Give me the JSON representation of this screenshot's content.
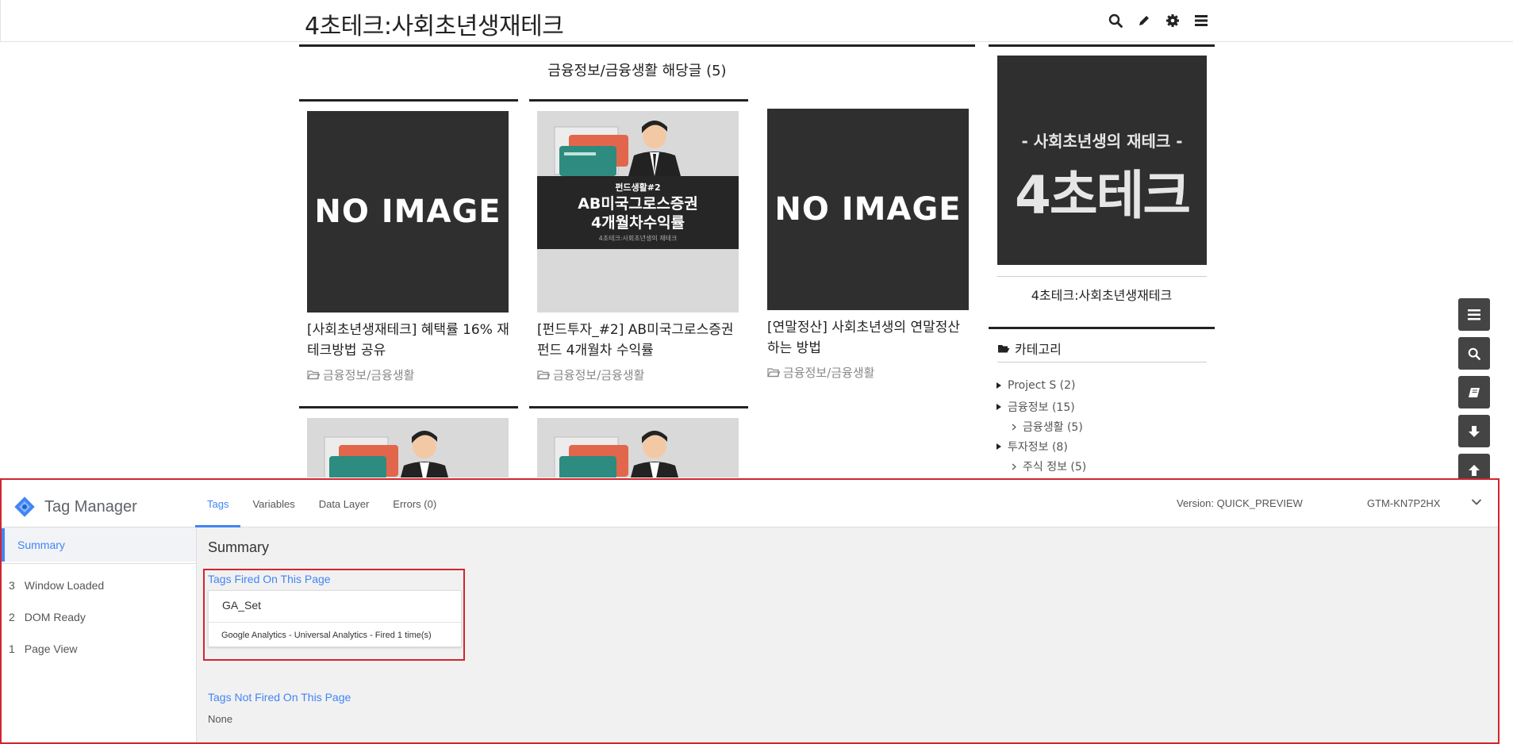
{
  "blog": {
    "title": "4초테크:사회초년생재테크",
    "heading": "금융정보/금융생활 해당글 (5)",
    "header_icons": [
      "search-icon",
      "pencil-icon",
      "gear-icon",
      "menu-icon"
    ],
    "posts": [
      {
        "thumb": "NO IMAGE",
        "title": "[사회초년생재테크] 혜택률 16% 재테크방법 공유",
        "category": "금융정보/금융생활"
      },
      {
        "thumb_l1": "펀드생활#2",
        "thumb_l2": "AB미국그로스증권",
        "thumb_l3": "4개월차수익률",
        "thumb_l4": "4초테크:사회초년생의 재테크",
        "title": "[펀드투자_#2] AB미국그로스증권 펀드 4개월차 수익률",
        "category": "금융정보/금융생활"
      },
      {
        "thumb": "NO IMAGE",
        "title": "[연말정산] 사회초년생의 연말정산 하는 방법",
        "category": "금융정보/금융생활"
      }
    ]
  },
  "sidebar": {
    "profile_line1": "- 사회초년생의 재테크 -",
    "profile_line2": "4초테크",
    "profile_name": "4초테크:사회초년생재테크",
    "category_title": "카테고리",
    "categories": [
      {
        "label": "Project S (2)",
        "level": 0
      },
      {
        "label": "금융정보 (15)",
        "level": 0
      },
      {
        "label": "금융생활 (5)",
        "level": 1
      },
      {
        "label": "투자정보 (8)",
        "level": 0
      },
      {
        "label": "주식 정보 (5)",
        "level": 1
      }
    ]
  },
  "floating_buttons": [
    "menu-icon",
    "search-icon",
    "book-icon",
    "arrow-down-icon",
    "arrow-up-icon"
  ],
  "gtm": {
    "brand": "Tag Manager",
    "tabs": [
      "Tags",
      "Variables",
      "Data Layer",
      "Errors (0)"
    ],
    "active_tab": "Tags",
    "version": "Version: QUICK_PREVIEW",
    "container_id": "GTM-KN7P2HX",
    "sidebar": {
      "summary": "Summary",
      "events": [
        {
          "num": "3",
          "label": "Window Loaded"
        },
        {
          "num": "2",
          "label": "DOM Ready"
        },
        {
          "num": "1",
          "label": "Page View"
        }
      ]
    },
    "main": {
      "title": "Summary",
      "fired_title": "Tags Fired On This Page",
      "fired_tag_name": "GA_Set",
      "fired_tag_desc": "Google Analytics - Universal Analytics - Fired 1 time(s)",
      "not_fired_title": "Tags Not Fired On This Page",
      "not_fired_value": "None"
    },
    "colors": {
      "accent": "#4285f4",
      "highlight": "#d0262f"
    }
  }
}
